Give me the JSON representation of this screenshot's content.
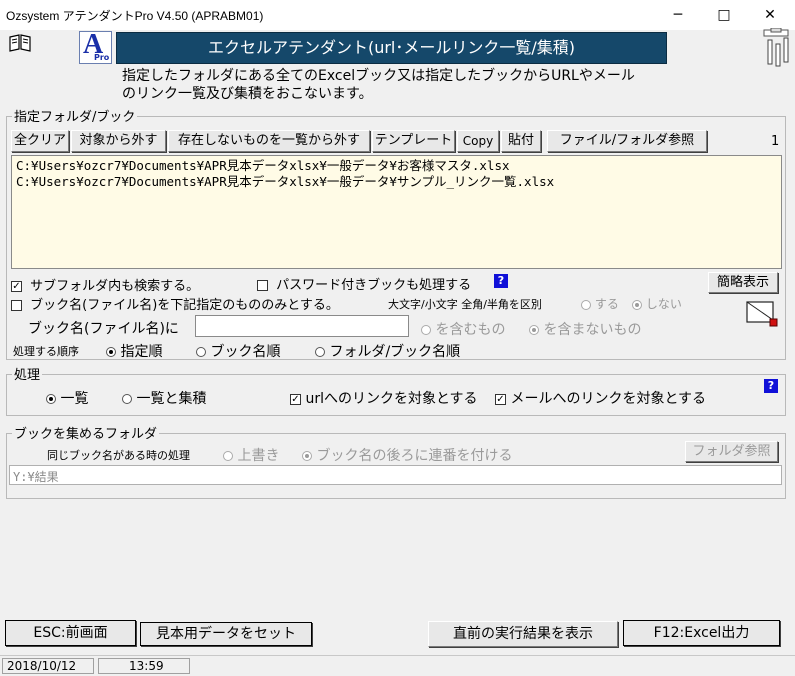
{
  "window": {
    "title": "Ozsystem アテンダントPro V4.50 (APRABM01)",
    "minimize": "─",
    "maximize": "□",
    "close": "✕"
  },
  "header": {
    "logo_letter": "A",
    "logo_sub": "Pro",
    "banner": "エクセルアテンダント(url･メールリンク一覧/集積)",
    "desc_line1": "指定したフォルダにある全てのExcelブック又は指定したブックからURLやメール",
    "desc_line2": "のリンク一覧及び集積をおこないます。",
    "accent": "#15486a"
  },
  "books": {
    "legend": "指定フォルダ/ブック",
    "toolbar": {
      "clear_all": "全クリア",
      "remove": "対象から外す",
      "remove_missing": "存在しないものを一覧から外す",
      "template": "テンプレート",
      "copy": "Copy",
      "paste": "貼付",
      "browse": "ファイル/フォルダ参照"
    },
    "count": "1",
    "list": [
      "C:¥Users¥ozcr7¥Documents¥APR見本データxlsx¥一般データ¥お客様マスタ.xlsx",
      "C:¥Users¥ozcr7¥Documents¥APR見本データxlsx¥一般データ¥サンプル_リンク一覧.xlsx"
    ],
    "list_bg": "#fffbe6",
    "subfolder_label": "サブフォルダ内も検索する。",
    "subfolder_checked": true,
    "password_label": "パスワード付きブックも処理する",
    "password_checked": false,
    "help": "?",
    "simple_view": "簡略表示",
    "name_filter_label": "ブック名(ファイル名)を下記指定のもののみとする。",
    "name_filter_checked": false,
    "case_label": "大文字/小文字 全角/半角を区別",
    "case_yes": "する",
    "case_no": "しない",
    "name_label": "ブック名(ファイル名)に",
    "name_value": "",
    "contains": "を含むもの",
    "not_contains": "を含まないもの",
    "order_label": "処理する順序",
    "order_specified": "指定順",
    "order_bookname": "ブック名順",
    "order_folder_book": "フォルダ/ブック名順"
  },
  "process": {
    "legend": "処理",
    "list_only": "一覧",
    "list_and_collect": "一覧と集積",
    "url_label": "urlへのリンクを対象とする",
    "url_checked": true,
    "mail_label": "メールへのリンクを対象とする",
    "mail_checked": true,
    "help": "?"
  },
  "collect": {
    "legend": "ブックを集めるフォルダ",
    "same_name_label": "同じブック名がある時の処理",
    "overwrite": "上書き",
    "append_number": "ブック名の後ろに連番を付ける",
    "browse": "フォルダ参照",
    "path": "Y:¥結果"
  },
  "footer": {
    "back": "ESC:前画面",
    "sample_data": "見本用データをセット",
    "show_last": "直前の実行結果を表示",
    "export": "F12:Excel出力",
    "date": "2018/10/12",
    "time": "13:59"
  }
}
